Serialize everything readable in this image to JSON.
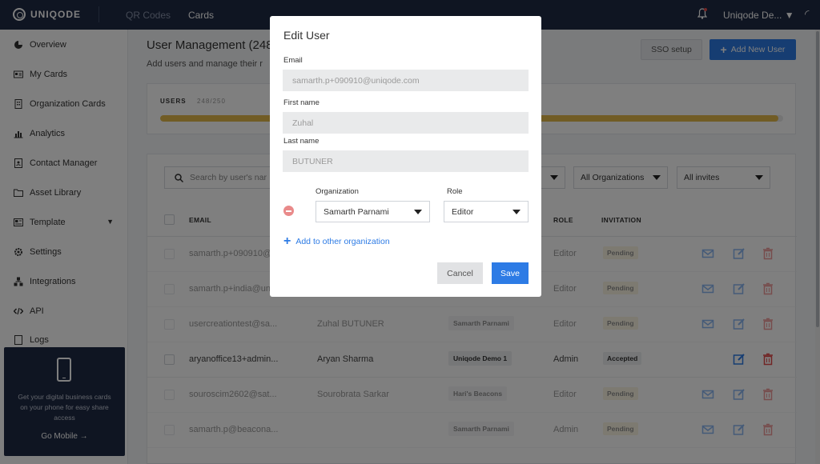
{
  "topbar": {
    "logo": "UNIQODE",
    "tabs": [
      "QR Codes",
      "Cards"
    ],
    "org_switcher": "Uniqode De...",
    "icons": [
      "bell-icon",
      "chevron-down-icon"
    ]
  },
  "sidebar": {
    "items": [
      {
        "label": "Overview",
        "icon": "pie-chart-icon"
      },
      {
        "label": "My Cards",
        "icon": "id-card-icon"
      },
      {
        "label": "Organization Cards",
        "icon": "building-icon"
      },
      {
        "label": "Analytics",
        "icon": "bar-chart-icon"
      },
      {
        "label": "Contact Manager",
        "icon": "contact-book-icon"
      },
      {
        "label": "Asset Library",
        "icon": "folder-icon"
      },
      {
        "label": "Template",
        "icon": "template-icon"
      },
      {
        "label": "Settings",
        "icon": "gear-icon"
      },
      {
        "label": "Integrations",
        "icon": "integrations-icon"
      },
      {
        "label": "API",
        "icon": "code-icon"
      },
      {
        "label": "Logs",
        "icon": "logs-icon"
      }
    ],
    "mobile_promo": {
      "text": "Get your digital business cards on your phone for easy share access",
      "cta": "Go Mobile →"
    }
  },
  "main": {
    "title": "User Management (248)",
    "subtitle": "Add users and manage their r",
    "sso_button": "SSO setup",
    "add_button": "Add New User",
    "users_card": {
      "label": "USERS",
      "count": "248/250",
      "used": 248,
      "limit": 250
    },
    "search_placeholder": "Search by user's nar",
    "filters": [
      "",
      "All Organizations",
      "All invites"
    ],
    "columns": [
      "EMAIL",
      "ROLE",
      "INVITATION"
    ],
    "rows": [
      {
        "email": "samarth.p+090910@...",
        "name": "",
        "org": "",
        "role": "Editor",
        "invitation": "Pending",
        "dim": true
      },
      {
        "email": "samarth.p+india@un...",
        "name": "",
        "org": "",
        "role": "Editor",
        "invitation": "Pending",
        "dim": true
      },
      {
        "email": "usercreationtest@sa...",
        "name": "Zuhal BUTUNER",
        "org": "Samarth Parnami",
        "role": "Editor",
        "invitation": "Pending",
        "dim": true
      },
      {
        "email": "aryanoffice13+admin...",
        "name": "Aryan Sharma",
        "org": "Uniqode Demo 1",
        "role": "Admin",
        "invitation": "Accepted",
        "dim": false
      },
      {
        "email": "souroscim2602@sat...",
        "name": "Sourobrata Sarkar",
        "org": "Hari's Beacons",
        "role": "Editor",
        "invitation": "Pending",
        "dim": true
      },
      {
        "email": "samarth.p@beacona...",
        "name": "",
        "org": "Samarth Parnami",
        "role": "Admin",
        "invitation": "Pending",
        "dim": true
      }
    ]
  },
  "modal": {
    "title": "Edit User",
    "email_label": "Email",
    "email_value": "samarth.p+090910@uniqode.com",
    "first_name_label": "First name",
    "first_name_value": "Zuhal",
    "last_name_label": "Last name",
    "last_name_value": "BUTUNER",
    "organization_label": "Organization",
    "organization_value": "Samarth Parnami",
    "role_label": "Role",
    "role_value": "Editor",
    "add_org_link": "Add to other organization",
    "cancel_button": "Cancel",
    "save_button": "Save"
  },
  "colors": {
    "primary": "#2d7be5",
    "topbar": "#1f2a44",
    "progress": "#e2b84a",
    "delete": "#e34b4b",
    "pending_bg": "#f8eccb"
  }
}
